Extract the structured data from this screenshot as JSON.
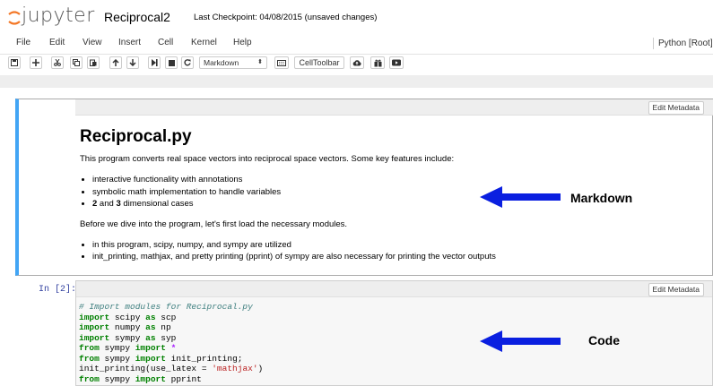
{
  "header": {
    "logo_text": "jupyter",
    "notebook_name": "Reciprocal2",
    "checkpoint": "Last Checkpoint: 04/08/2015 (unsaved changes)"
  },
  "menubar": {
    "items": [
      "File",
      "Edit",
      "View",
      "Insert",
      "Cell",
      "Kernel",
      "Help"
    ],
    "kernel": "Python [Root]"
  },
  "toolbar": {
    "cell_type": "Markdown",
    "celltoolbar_label": "CellToolbar",
    "icons": [
      "save-icon",
      "plus-icon",
      "cut-icon",
      "copy-icon",
      "paste-icon",
      "arrow-up-icon",
      "arrow-down-icon",
      "step-forward-icon",
      "stop-icon",
      "restart-icon",
      "keyboard-icon",
      "cloud-upload-icon",
      "gift-icon",
      "youtube-icon"
    ]
  },
  "markdown_cell": {
    "edit_metadata_label": "Edit Metadata",
    "heading": "Reciprocal.py",
    "intro": "This program converts real space vectors into reciprocal space vectors. Some key features include:",
    "features": [
      "interactive functionality with annotations",
      "symbolic math implementation to handle variables"
    ],
    "feature3": {
      "bold1": "2",
      "mid": " and ",
      "bold2": "3",
      "rest": " dimensional cases"
    },
    "modules_intro": "Before we dive into the program, let's first load the necessary modules.",
    "module_notes": [
      "in this program, scipy, numpy, and sympy are utilized",
      "init_printing, mathjax, and pretty printing (pprint) of sympy are also necessary for printing the vector outputs"
    ]
  },
  "code_cell": {
    "prompt": "In [2]:",
    "edit_metadata_label": "Edit Metadata",
    "comment": "# Import modules for Reciprocal.py",
    "lines": [
      {
        "kw1": "import",
        "a": " scipy ",
        "kw2": "as",
        "b": " scp"
      },
      {
        "kw1": "import",
        "a": " numpy ",
        "kw2": "as",
        "b": " np"
      },
      {
        "kw1": "import",
        "a": " sympy ",
        "kw2": "as",
        "b": " syp"
      },
      {
        "kw1": "from",
        "a": " sympy ",
        "kw2": "import",
        "b": " *"
      },
      {
        "kw1": "from",
        "a": " sympy ",
        "kw2": "import",
        "b": " init_printing;"
      }
    ],
    "latex_line": {
      "pre": "init_printing(use_latex = ",
      "str": "'mathjax'",
      "post": ")"
    },
    "last_line": {
      "kw1": "from",
      "a": " sympy ",
      "kw2": "import",
      "b": " pprint"
    }
  },
  "annotations": {
    "markdown_label": "Markdown",
    "code_label": "Code",
    "arrow_color": "#0a1fe0"
  },
  "colors": {
    "selected_cell_border": "#42a5f5",
    "logo_orange": "#f37726",
    "prompt_blue": "#303f9f"
  }
}
